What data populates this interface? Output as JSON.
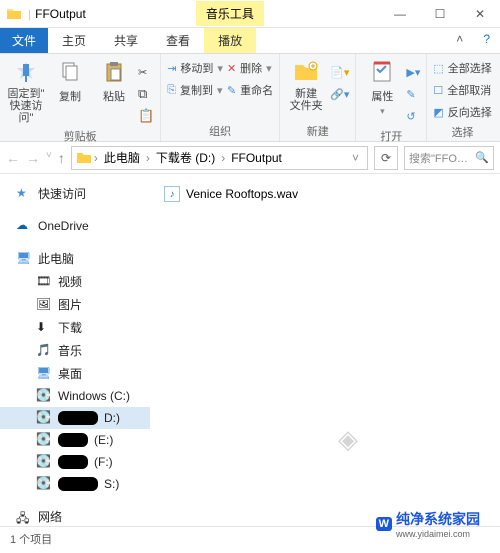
{
  "title": "FFOutput",
  "context_tab": "音乐工具",
  "tabs": {
    "file": "文件",
    "home": "主页",
    "share": "共享",
    "view": "查看",
    "play": "播放"
  },
  "ribbon": {
    "clipboard": {
      "pin": "固定到\"\n快速访问\"",
      "copy": "复制",
      "paste": "粘贴",
      "label": "剪贴板"
    },
    "organize": {
      "moveto": "移动到",
      "copyto": "复制到",
      "delete": "删除",
      "rename": "重命名",
      "label": "组织"
    },
    "new": {
      "newfolder": "新建\n文件夹",
      "label": "新建"
    },
    "open": {
      "properties": "属性",
      "label": "打开"
    },
    "select": {
      "selectall": "全部选择",
      "selectnone": "全部取消",
      "invert": "反向选择",
      "label": "选择"
    }
  },
  "breadcrumb": {
    "pc": "此电脑",
    "drive": "下载卷 (D:)",
    "folder": "FFOutput"
  },
  "search_placeholder": "搜索\"FFOu…",
  "sidebar": {
    "quick": "快速访问",
    "onedrive": "OneDrive",
    "pc": "此电脑",
    "videos": "视频",
    "pictures": "图片",
    "downloads": "下载",
    "music": "音乐",
    "desktop": "桌面",
    "cdrive": "Windows (C:)",
    "ddrive": "D:)",
    "edrive": "(E:)",
    "fdrive": "(F:)",
    "sdrive": "S:)",
    "network": "网络"
  },
  "files": [
    {
      "name": "Venice Rooftops.wav"
    }
  ],
  "status": "1 个项目",
  "watermark": "纯净系统家园",
  "watermark_url": "www.yidaimei.com"
}
